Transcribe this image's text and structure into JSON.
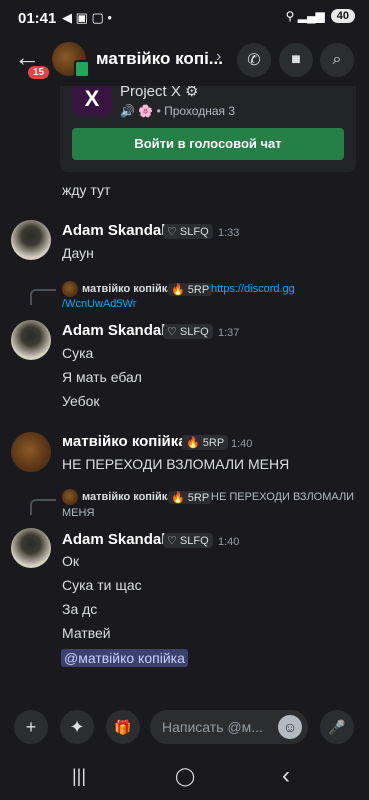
{
  "status_bar": {
    "time": "01:41",
    "icons": "◀ ▣ ▢ •",
    "signal": "⚲ ▂▄▆",
    "battery": "40"
  },
  "header": {
    "back_icon": "←",
    "unread_badge": "15",
    "title": "матвійко копі...",
    "chevron": "›",
    "call_icon": "✆",
    "video_icon": "■",
    "search_icon": "⌕"
  },
  "invite": {
    "server_icon": "X",
    "server_name": "Project X",
    "server_emoji": "⚙",
    "channel_icon": "🔊 🌸",
    "channel": "• Проходная 3",
    "join_label": "Войти в голосовой чат"
  },
  "messages": [
    {
      "text": "жду тут"
    },
    {
      "author": "Adam Skandal",
      "tag": "♡ SLFQ",
      "time": "1:33",
      "lines": [
        "Даун"
      ]
    },
    {
      "reply": {
        "author": "матвійко копійка",
        "tag": "🔥 5RP",
        "text_line1": "https://discord.gg",
        "text_line2": "/WcnUwAd5Wr"
      },
      "author": "Adam Skandal",
      "tag": "♡ SLFQ",
      "time": "1:37",
      "lines": [
        "Сука",
        "Я мать ебал",
        "Уебок"
      ]
    },
    {
      "author": "матвійко копійка",
      "tag": "🔥 5RP",
      "time": "1:40",
      "lines": [
        "НЕ ПЕРЕХОДИ ВЗЛОМАЛИ МЕНЯ"
      ]
    },
    {
      "reply": {
        "author": "матвійко копійка",
        "tag": "🔥 5RP",
        "text_line1": "НЕ ПЕРЕХОДИ ВЗЛОМАЛИ",
        "text_line2": "МЕНЯ"
      },
      "author": "Adam Skandal",
      "tag": "♡ SLFQ",
      "time": "1:40",
      "lines": [
        "Ок",
        "Сука ти щас",
        "За дс",
        "Матвей"
      ],
      "mention": "@матвійко копійка"
    }
  ],
  "composer": {
    "plus_icon": "+",
    "apps_icon": "✦",
    "gift_icon": "🎁",
    "placeholder": "Написать @м...",
    "emoji_icon": "☺",
    "mic_icon": "🎤"
  },
  "nav": {
    "recents": "|||",
    "home": "◯",
    "back": "‹"
  },
  "colors": {
    "join_button": "#248046",
    "mention_bg": "#3c4270",
    "link": "#00a8fc",
    "badge": "#f23f43"
  }
}
